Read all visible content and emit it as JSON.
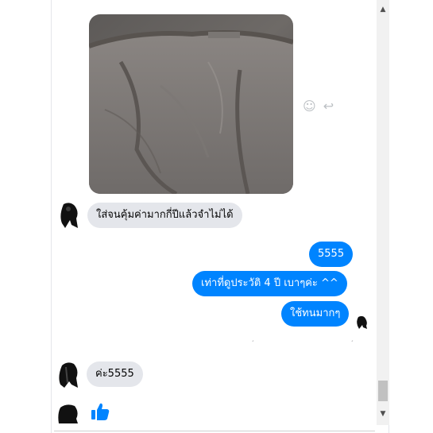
{
  "messages": {
    "received_1": "ใส่จนคุ้มค่ามากกี่ปีแล้วจำไม่ได้",
    "sent_1": "5555",
    "sent_2": "เท่าที่ดูประวัติ   4 ปี เบาๆค่ะ ^^",
    "sent_3": "ใช้ทนมากๆ",
    "received_2": "ค่ะ5555"
  },
  "icons": {
    "emoji_reaction": "smiley-icon",
    "reply": "reply-icon",
    "like": "thumbs-up-icon",
    "scroll_up": "arrow-up-icon",
    "scroll_down": "arrow-down-icon"
  },
  "colors": {
    "outgoing_bubble": "#0084ff",
    "incoming_bubble": "#e4e6eb",
    "like_icon": "#0084ff"
  },
  "glyphs": {
    "smiley": "☺",
    "reply": "↩",
    "scroll_up": "▲",
    "scroll_down": "▼"
  }
}
